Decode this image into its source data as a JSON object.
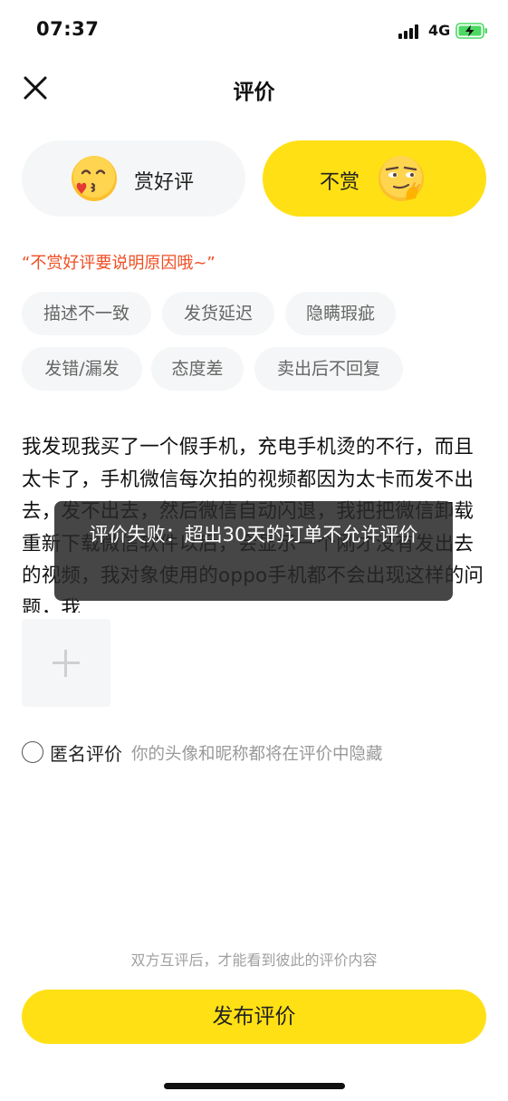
{
  "status_bar": {
    "time": "07:37",
    "network": "4G",
    "icons": [
      "signal-icon",
      "battery-charging-icon"
    ]
  },
  "header": {
    "title": "评价",
    "close_icon": "close-icon"
  },
  "rating": {
    "good_label": "赏好评",
    "bad_label": "不赏",
    "selected": "bad",
    "good_icon": "blowing-kiss-emoji-icon",
    "bad_icon": "smirking-face-emoji-icon"
  },
  "hint": "“不赏好评要说明原因哦~”",
  "tags": {
    "row1": [
      "描述不一致",
      "发货延迟",
      "隐瞒瑕疵"
    ],
    "row2": [
      "发错/漏发",
      "态度差",
      "卖出后不回复"
    ]
  },
  "review_text": "我发现我买了一个假手机，充电手机烫的不行，而且太卡了，手机微信每次拍的视频都因为太卡而发不出去，发不出去，然后微信自动闪退，我把把微信卸载重新下载微信软件以后，会显示一个刚才没有发出去的视频，我对象使用的oppo手机都不会出现这样的问题，我",
  "upload": {
    "icon": "plus-icon"
  },
  "anonymous": {
    "label": "匿名评价",
    "description": "你的头像和昵称都将在评价中隐藏"
  },
  "footer": {
    "note": "双方互评后，才能看到彼此的评价内容",
    "publish_label": "发布评价"
  },
  "toast": {
    "message": "评价失败：超出30天的订单不允许评价"
  },
  "colors": {
    "accent": "#ffe014",
    "hint": "#f04e23",
    "tag_bg": "#f5f6f7"
  }
}
